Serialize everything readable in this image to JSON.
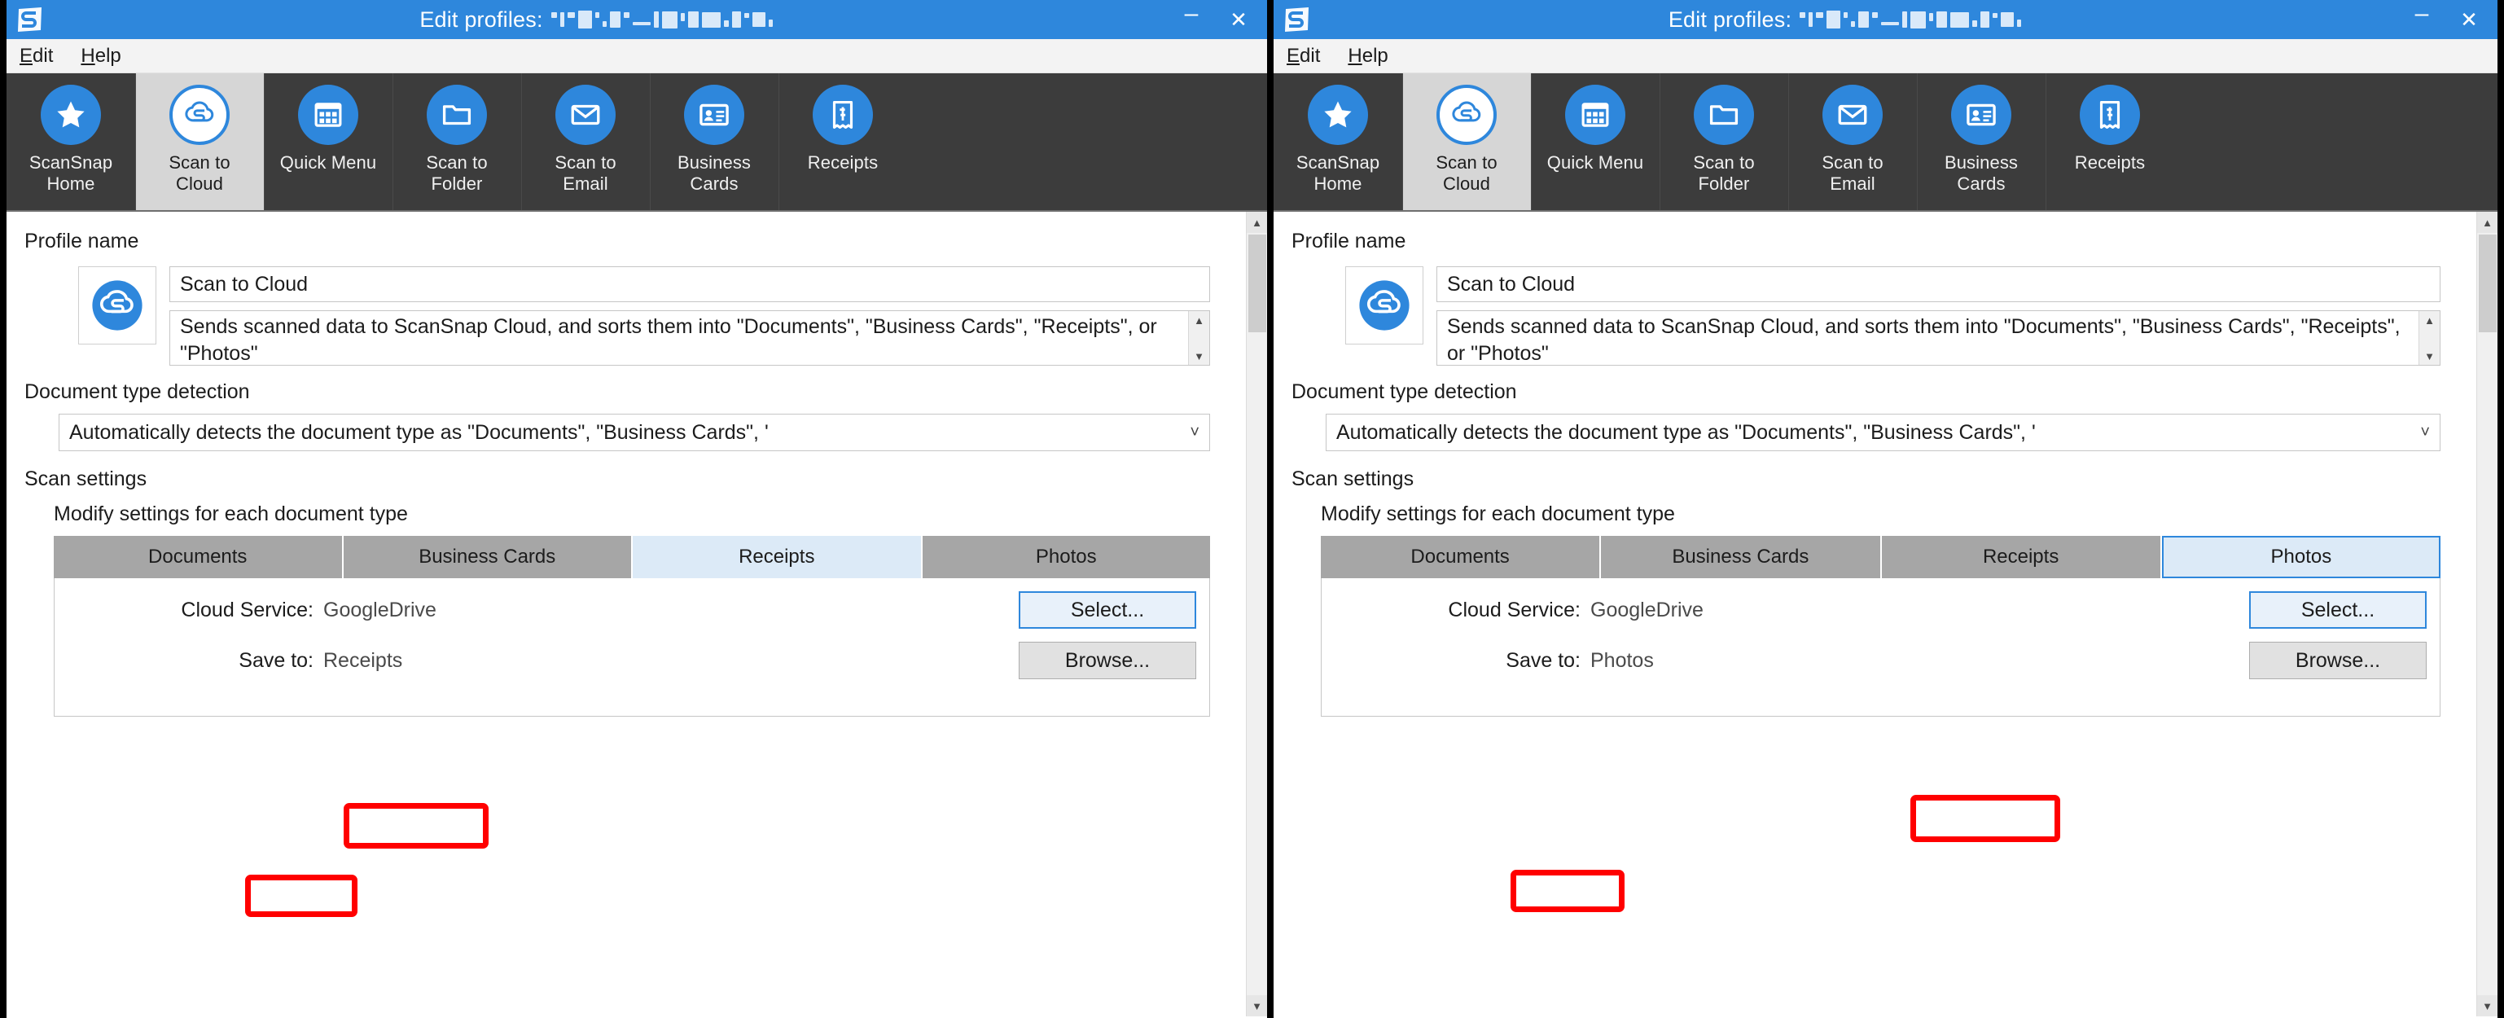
{
  "app": {
    "title_prefix": "Edit profiles:",
    "redacted_title": "redacted-filename-blocks",
    "accent_blue": "#2e87dc",
    "toolbar_bg": "#3c3c3c",
    "highlight_red": "#ff0000"
  },
  "titlebar": {
    "logo_icon": "scansnap-logo-icon",
    "minimize_label": "–",
    "close_label": "✕"
  },
  "menubar": {
    "items": [
      {
        "label": "Edit",
        "mnemonic": "E",
        "rest": "dit"
      },
      {
        "label": "Help",
        "mnemonic": "H",
        "rest": "elp"
      }
    ]
  },
  "toolbar": {
    "items": [
      {
        "label_line1": "ScanSnap",
        "label_line2": "Home",
        "icon": "star-icon",
        "selected": false
      },
      {
        "label_line1": "Scan to",
        "label_line2": "Cloud",
        "icon": "scansnap-cloud-icon",
        "selected": true
      },
      {
        "label_line1": "Quick Menu",
        "label_line2": "",
        "icon": "grid-menu-icon",
        "selected": false
      },
      {
        "label_line1": "Scan to",
        "label_line2": "Folder",
        "icon": "folder-icon",
        "selected": false
      },
      {
        "label_line1": "Scan to",
        "label_line2": "Email",
        "icon": "envelope-icon",
        "selected": false
      },
      {
        "label_line1": "Business",
        "label_line2": "Cards",
        "icon": "business-card-icon",
        "selected": false
      },
      {
        "label_line1": "Receipts",
        "label_line2": "",
        "icon": "receipt-icon",
        "selected": false
      }
    ]
  },
  "form": {
    "profile_name_label": "Profile name",
    "profile_icon": "scansnap-cloud-icon",
    "profile_name_value": "Scan to Cloud",
    "profile_description_value": "Sends scanned data to ScanSnap Cloud, and sorts them into \"Documents\", \"Business Cards\", \"Receipts\", or \"Photos\"",
    "doc_type_label": "Document type detection",
    "doc_type_value": "Automatically detects the document type as \"Documents\", \"Business Cards\", '",
    "doc_type_chevron": "chevron-down-icon",
    "scan_settings_label": "Scan settings",
    "modify_settings_label": "Modify settings for each document type",
    "tabs": [
      "Documents",
      "Business Cards",
      "Receipts",
      "Photos"
    ],
    "cloud_service_label": "Cloud Service:",
    "cloud_service_value": "GoogleDrive",
    "save_to_label": "Save to:",
    "select_button": "Select...",
    "browse_button": "Browse...",
    "scroll_up": "▲",
    "scroll_down": "▼"
  },
  "panels": {
    "left": {
      "active_tab": "Receipts",
      "active_tab_index": 2,
      "save_to_value": "Receipts",
      "tab_highlight_style": "red-box",
      "cloud_service_highlight": "red-box"
    },
    "right": {
      "active_tab": "Photos",
      "active_tab_index": 3,
      "save_to_value": "Photos",
      "tab_highlight_style": "red-box-selected-blue",
      "cloud_service_highlight": "red-box"
    }
  }
}
